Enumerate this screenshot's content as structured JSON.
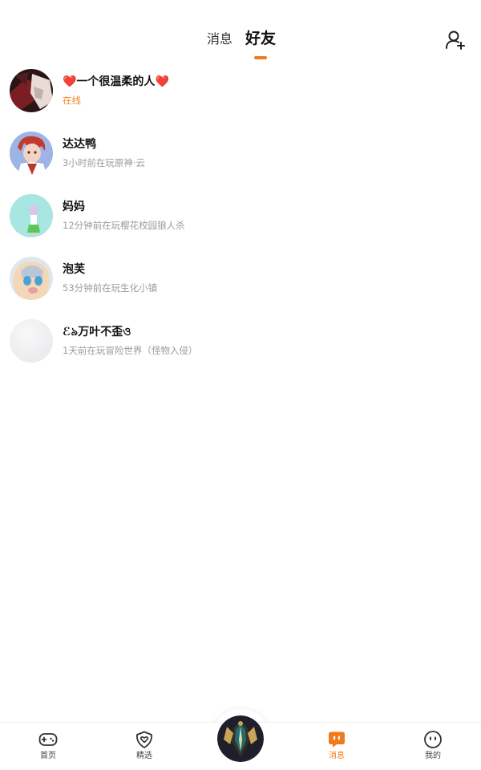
{
  "header": {
    "tabs": [
      {
        "label": "消息",
        "active": false
      },
      {
        "label": "好友",
        "active": true
      }
    ],
    "accent_color": "#f07b1d",
    "add_friend_icon": "add-user-icon"
  },
  "friends": [
    {
      "name_prefix": "❤️",
      "name": "一个很温柔的人",
      "name_suffix": "❤️",
      "status": "在线",
      "online": true,
      "avatar": "avatar-dark-red"
    },
    {
      "name": "达达鸭",
      "status": "3小时前在玩原神·云",
      "online": false,
      "avatar": "avatar-red-hair"
    },
    {
      "name": "妈妈",
      "status": "12分钟前在玩樱花校园狼人杀",
      "online": false,
      "avatar": "avatar-cyan"
    },
    {
      "name": "泡芙",
      "status": "53分钟前在玩生化小镇",
      "online": false,
      "avatar": "avatar-anime-girl"
    },
    {
      "name": "ℰ৯万叶不歪ও",
      "status": "1天前在玩冒险世界（怪物入侵）",
      "online": false,
      "avatar": "avatar-blank"
    }
  ],
  "bottom_nav": {
    "items": [
      {
        "label": "首页",
        "icon": "gamepad-icon",
        "active": false
      },
      {
        "label": "精选",
        "icon": "heart-shield-icon",
        "active": false
      },
      {
        "label": "消息",
        "icon": "chat-bubble-icon",
        "active": true
      },
      {
        "label": "我的",
        "icon": "smiley-face-icon",
        "active": false
      }
    ],
    "center_button_icon": "game-emblem-icon"
  }
}
